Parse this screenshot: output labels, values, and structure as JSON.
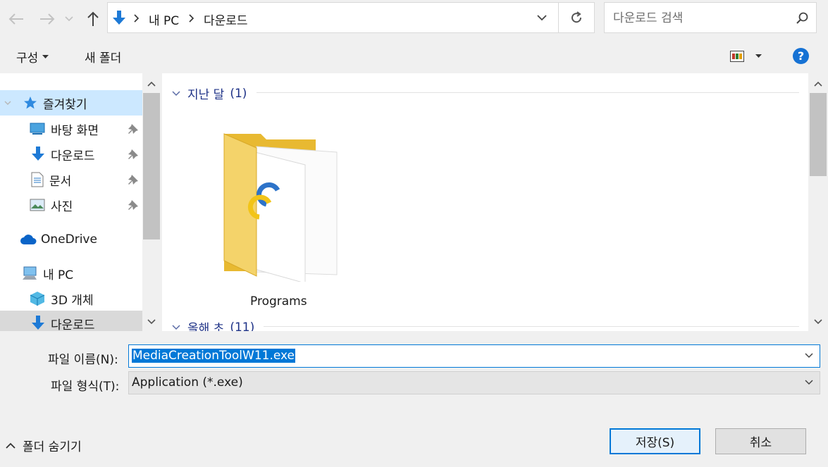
{
  "address_bar": {
    "breadcrumb": [
      "내 PC",
      "다운로드"
    ],
    "search_placeholder": "다운로드 검색"
  },
  "toolbar": {
    "organize_label": "구성",
    "new_folder_label": "새 폴더"
  },
  "nav": {
    "quick_access": "즐겨찾기",
    "items": [
      {
        "label": "바탕 화면",
        "icon": "desktop-icon",
        "pinned": true
      },
      {
        "label": "다운로드",
        "icon": "download-icon",
        "pinned": true
      },
      {
        "label": "문서",
        "icon": "documents-icon",
        "pinned": true
      },
      {
        "label": "사진",
        "icon": "pictures-icon",
        "pinned": true
      }
    ],
    "onedrive": "OneDrive",
    "this_pc": "내 PC",
    "pc_items": [
      {
        "label": "3D 개체",
        "icon": "3d-objects-icon"
      },
      {
        "label": "다운로드",
        "icon": "download-icon"
      }
    ]
  },
  "content": {
    "groups": [
      {
        "name": "지난 달",
        "count": "(1)"
      },
      {
        "name": "올해 초",
        "count": "(11)"
      }
    ],
    "files": [
      {
        "name": "Programs",
        "icon": "folder-icon"
      }
    ]
  },
  "form": {
    "filename_label": "파일 이름(N):",
    "filename_value": "MediaCreationToolW11.exe",
    "filetype_label": "파일 형식(T):",
    "filetype_value": "Application (*.exe)"
  },
  "footer": {
    "hide_folders_label": "폴더 숨기기",
    "save_label": "저장(S)",
    "cancel_label": "취소"
  },
  "colors": {
    "accent": "#0078d7",
    "group_header": "#1e3287",
    "selected_nav": "#cce8ff"
  }
}
